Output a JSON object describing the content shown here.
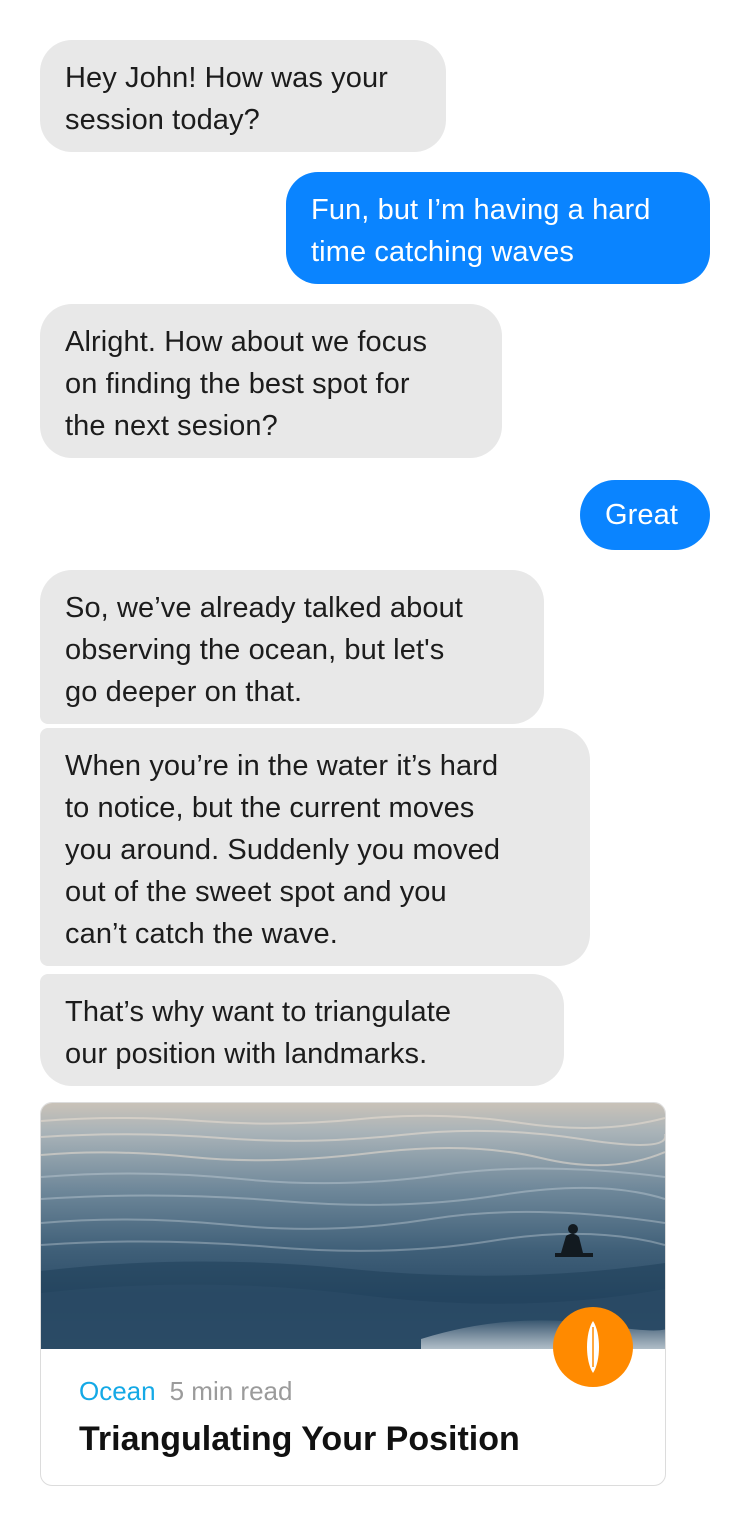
{
  "messages": [
    {
      "from": "coach",
      "text": "Hey John! How was your\nsession today?"
    },
    {
      "from": "user",
      "text": "Fun, but I’m having a hard\ntime catching waves"
    },
    {
      "from": "coach",
      "text": "Alright. How about we focus\non finding the best spot for\nthe next sesion?"
    },
    {
      "from": "user",
      "text": "Great"
    },
    {
      "from": "coach",
      "text": "So, we’ve already talked about\nobserving the ocean, but let's\ngo deeper on that."
    },
    {
      "from": "coach",
      "text": "When you’re in the water it’s hard\nto notice, but the current moves\nyou around. Suddenly you moved\nout of the sweet spot and you\ncan’t catch the wave."
    },
    {
      "from": "coach",
      "text": "That’s why want to triangulate\nour position with landmarks."
    }
  ],
  "article_card": {
    "category": "Ocean",
    "read_time": "5 min read",
    "title": "Triangulating Your Position",
    "image": "ocean-surfer-photo",
    "badge_icon": "surfboard-icon"
  },
  "colors": {
    "incoming_bubble": "#e8e8e8",
    "outgoing_bubble": "#0a84ff",
    "category": "#14a9e6",
    "badge": "#ff8a00"
  }
}
